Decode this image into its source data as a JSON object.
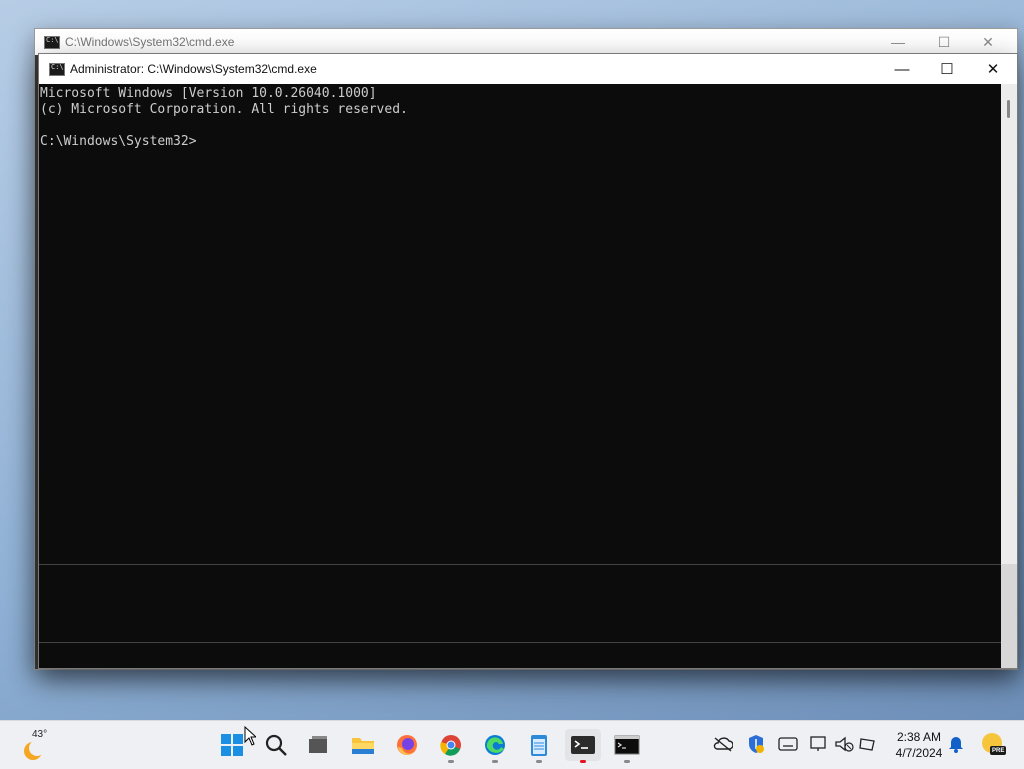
{
  "back_window": {
    "title": "C:\\Windows\\System32\\cmd.exe",
    "controls": {
      "minimize": "—",
      "maximize": "☐",
      "close": "✕"
    }
  },
  "front_window": {
    "title": "Administrator: C:\\Windows\\System32\\cmd.exe",
    "controls": {
      "minimize": "—",
      "maximize": "☐",
      "close": "✕"
    },
    "console_lines": [
      "Microsoft Windows [Version 10.0.26040.1000]",
      "(c) Microsoft Corporation. All rights reserved.",
      "",
      "C:\\Windows\\System32>"
    ]
  },
  "taskbar": {
    "weather": {
      "temp": "43°",
      "icon": "weather-sun-icon"
    },
    "apps": [
      {
        "name": "start-button",
        "icon": "windows-logo-icon"
      },
      {
        "name": "search-button",
        "icon": "search-icon"
      },
      {
        "name": "task-view-button",
        "icon": "task-view-icon"
      },
      {
        "name": "file-explorer-button",
        "icon": "folder-icon"
      },
      {
        "name": "firefox-button",
        "icon": "firefox-icon"
      },
      {
        "name": "chrome-button",
        "icon": "chrome-icon"
      },
      {
        "name": "edge-button",
        "icon": "edge-icon"
      },
      {
        "name": "notepad-button",
        "icon": "notepad-icon"
      },
      {
        "name": "terminal-button",
        "icon": "terminal-icon"
      },
      {
        "name": "cmd-button",
        "icon": "cmd-icon"
      }
    ],
    "tray_icons": [
      "onedrive-offline-icon",
      "security-shield-icon",
      "keyboard-icon",
      "network-icon",
      "volume-muted-icon",
      "battery-icon"
    ],
    "clock": {
      "time": "2:38 AM",
      "date": "4/7/2024"
    },
    "notification_icon": "bell-icon",
    "pre_badge": "PRE"
  },
  "colors": {
    "console_bg": "#0c0c0c",
    "console_text": "#cccccc",
    "taskbar_bg": "#eef0f4",
    "accent_blue": "#0078d4"
  }
}
